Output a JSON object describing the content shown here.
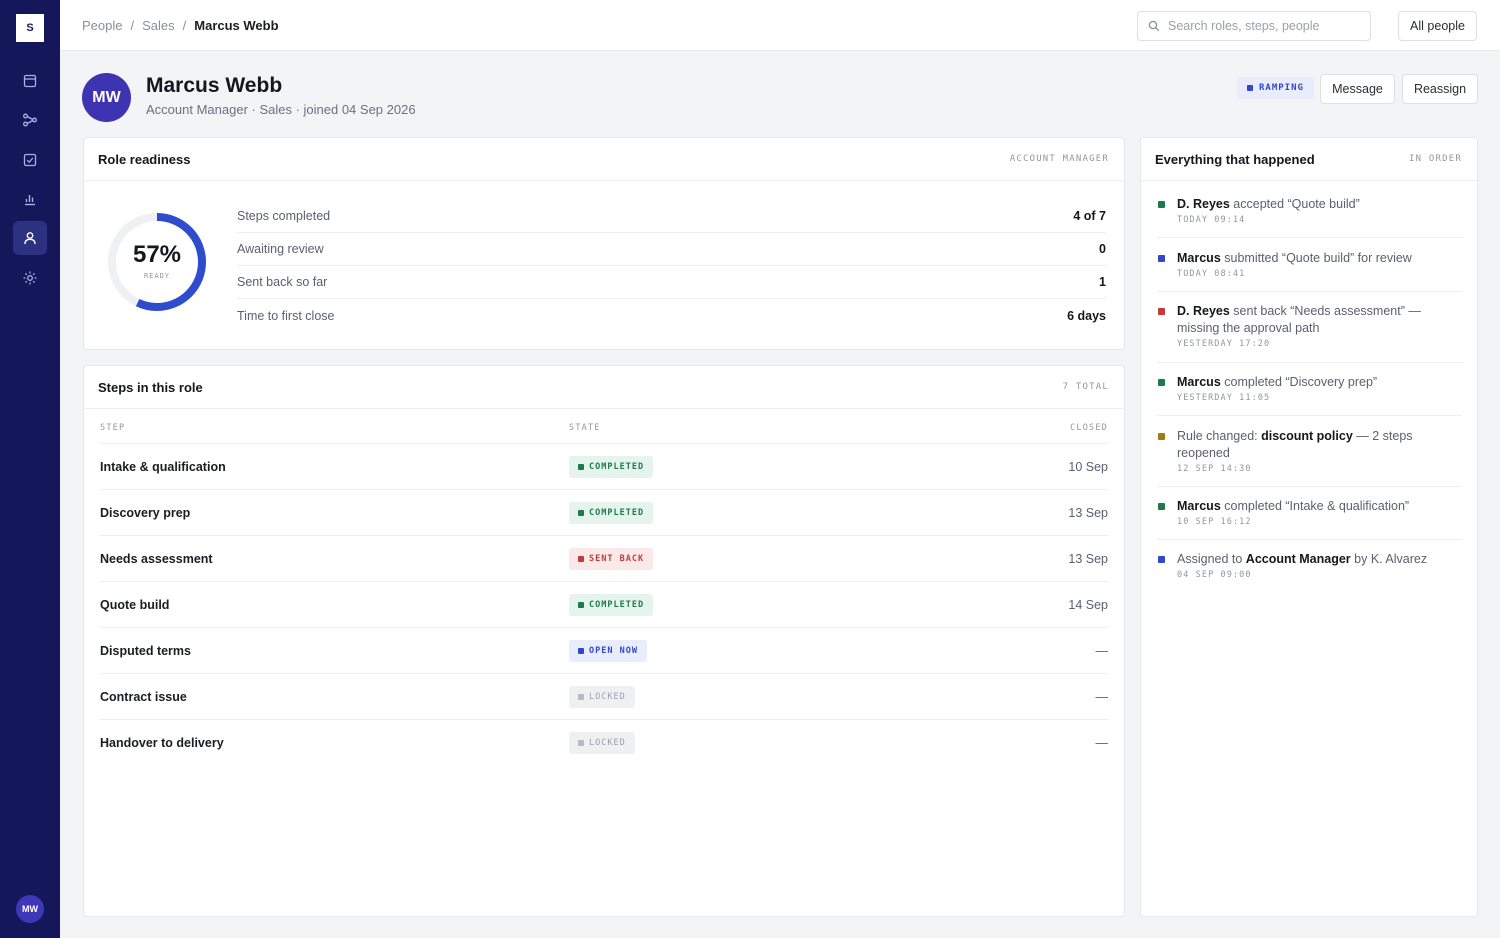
{
  "app": {
    "logo_letter": "S",
    "user_initials": "MW"
  },
  "nav": {
    "items": [
      "calendar-icon",
      "flow-icon",
      "checkbox-icon",
      "chart-icon",
      "user-icon",
      "settings-icon"
    ],
    "active": "user-icon"
  },
  "breadcrumb": {
    "items": [
      "People",
      "Sales"
    ],
    "current": "Marcus Webb",
    "separator": "/"
  },
  "search": {
    "placeholder": "Search roles, steps, people"
  },
  "topbar": {
    "all_people_label": "All people"
  },
  "person": {
    "initials": "MW",
    "name": "Marcus Webb",
    "subtitle": "Account Manager · Sales · joined 04 Sep 2026",
    "status": "RAMPING",
    "message_label": "Message",
    "reassign_label": "Reassign"
  },
  "readiness": {
    "title": "Role readiness",
    "tag": "ACCOUNT MANAGER",
    "percent": 57,
    "percent_label": "57%",
    "ready_label": "READY",
    "stats": [
      {
        "label": "Steps completed",
        "value": "4 of 7"
      },
      {
        "label": "Awaiting review",
        "value": "0"
      },
      {
        "label": "Sent back so far",
        "value": "1"
      },
      {
        "label": "Time to first close",
        "value": "6 days"
      }
    ]
  },
  "steps": {
    "title": "Steps in this role",
    "tag": "7 TOTAL",
    "columns": {
      "step": "STEP",
      "state": "STATE",
      "closed": "CLOSED"
    },
    "rows": [
      {
        "name": "Intake & qualification",
        "state": "COMPLETED",
        "kind": "completed",
        "closed": "10 Sep"
      },
      {
        "name": "Discovery prep",
        "state": "COMPLETED",
        "kind": "completed",
        "closed": "13 Sep"
      },
      {
        "name": "Needs assessment",
        "state": "SENT BACK",
        "kind": "sentback",
        "closed": "13 Sep"
      },
      {
        "name": "Quote build",
        "state": "COMPLETED",
        "kind": "completed",
        "closed": "14 Sep"
      },
      {
        "name": "Disputed terms",
        "state": "OPEN NOW",
        "kind": "open",
        "closed": "—"
      },
      {
        "name": "Contract issue",
        "state": "LOCKED",
        "kind": "locked",
        "closed": "—"
      },
      {
        "name": "Handover to delivery",
        "state": "LOCKED",
        "kind": "locked",
        "closed": "—"
      }
    ]
  },
  "timeline": {
    "title": "Everything that happened",
    "tag": "IN ORDER",
    "events": [
      {
        "actor": "D. Reyes",
        "text": " accepted “Quote build”",
        "time": "TODAY 09:14",
        "color": "#1d7a4b"
      },
      {
        "actor": "Marcus",
        "text": " submitted “Quote build” for review",
        "time": "TODAY 08:41",
        "color": "#3148c7"
      },
      {
        "actor": "D. Reyes",
        "text": " sent back “Needs assessment” — missing the approval path",
        "time": "YESTERDAY 17:20",
        "color": "#c23b3b"
      },
      {
        "actor": "Marcus",
        "text": " completed “Discovery prep”",
        "time": "YESTERDAY 11:05",
        "color": "#1d7a4b"
      },
      {
        "pre": "Rule changed: ",
        "actor": "discount policy",
        "text": " — 2 steps reopened",
        "time": "12 SEP 14:30",
        "color": "#a07a12"
      },
      {
        "actor": "Marcus",
        "text": " completed “Intake & qualification”",
        "time": "10 SEP 16:12",
        "color": "#1d7a4b"
      },
      {
        "pre": "Assigned to ",
        "actor": "Account Manager",
        "text": " by K. Alvarez",
        "time": "04 SEP 09:00",
        "color": "#3148c7"
      }
    ]
  },
  "colors": {
    "sidebar": "#14185a",
    "accent": "#3148c7",
    "completed": "#1d7a4b",
    "sent_back": "#c23b3b",
    "rule": "#a07a12"
  }
}
